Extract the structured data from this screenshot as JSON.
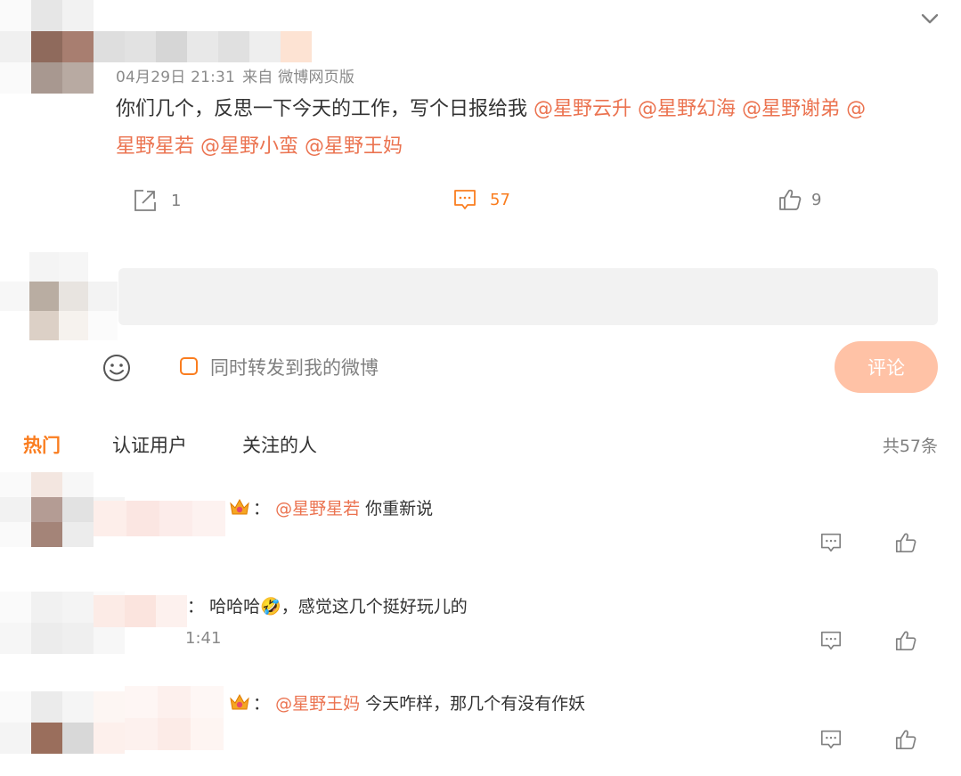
{
  "post": {
    "date": "04月29日 21:31",
    "source": "来自 微博网页版",
    "text": "你们几个，反思一下今天的工作，写个日报给我",
    "mentions_line1": [
      "@星野云升",
      "@星野幻海",
      "@星野谢弟",
      "@"
    ],
    "mentions_line2": [
      "星野星若",
      "@星野小蛮",
      "@星野王妈"
    ],
    "repost_count": "1",
    "comment_count": "57",
    "like_count": "9"
  },
  "composer": {
    "repost_label": "同时转发到我的微博",
    "submit_label": "评论"
  },
  "tabs": [
    "热门",
    "认证用户",
    "关注的人"
  ],
  "total_label": "共57条",
  "comments": [
    {
      "colon": "：",
      "mention": "@星野星若",
      "text": "你重新说"
    },
    {
      "colon": "：",
      "text": "哈哈哈🤣，感觉这几个挺好玩儿的",
      "time": "1:41"
    },
    {
      "colon": "：",
      "mention": "@星野王妈",
      "text": "今天咋样，那几个有没有作妖"
    }
  ],
  "colors": {
    "accent": "#fa7d1f",
    "mention": "#eb7350",
    "button_disabled": "#ffc2a6",
    "composer_bg": "#f2f2f2"
  },
  "icons": [
    "chevron-down-icon",
    "repost-icon",
    "comment-icon",
    "like-icon",
    "emoji-icon",
    "crown-icon"
  ]
}
